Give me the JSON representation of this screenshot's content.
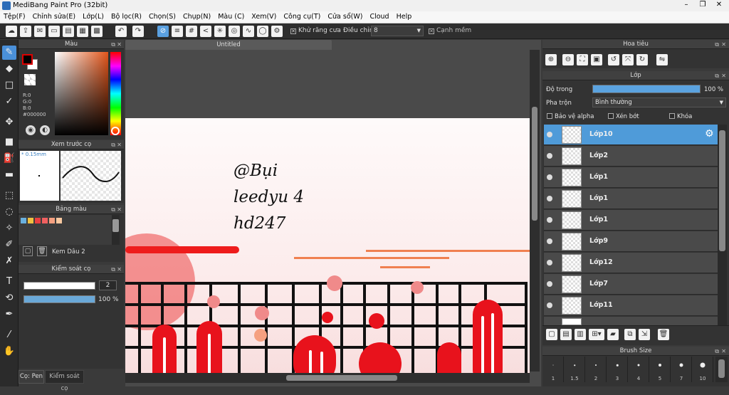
{
  "window": {
    "title": "MediBang Paint Pro (32bit)",
    "minimize": "–",
    "maximize": "❐",
    "close": "✕"
  },
  "menu": [
    "Tệp(F)",
    "Chỉnh sửa(E)",
    "Lớp(L)",
    "Bộ lọc(R)",
    "Chọn(S)",
    "Chụp(N)",
    "Màu (C)",
    "Xem(V)",
    "Công cụ(T)",
    "Cửa sổ(W)",
    "Cloud",
    "Help"
  ],
  "toolbar": {
    "antialias_label": "Khử răng cưa",
    "adjust_label": "Điều chỉnh",
    "adjust_value": "8",
    "smooth_edge_label": "Cạnh mềm"
  },
  "color_panel": {
    "title": "Màu",
    "r": "R:0",
    "g": "G:0",
    "b": "B:0",
    "hex": "#000000"
  },
  "brush_preview": {
    "title": "Xem trước cọ",
    "size": "* 0.15mm"
  },
  "palette": {
    "title": "Bảng màu",
    "name": "Kem Dâu 2",
    "colors": [
      "#6ab0de",
      "#f0c040",
      "#e84040",
      "#f06060",
      "#f5a080",
      "#f8c8a0"
    ]
  },
  "brush_control": {
    "title": "Kiểm soát cọ",
    "size_value": "2",
    "opacity_value": "100 %",
    "opacity_fraction": 1.0
  },
  "bottom_tabs": [
    "Cọ: Pen",
    "Kiểm soát cọ"
  ],
  "document": {
    "tab": "Untitled",
    "handwriting": [
      "@Bụi",
      "leedyu 4",
      "hd247"
    ]
  },
  "navigator": {
    "title": "Hoa tiêu"
  },
  "layers": {
    "title": "Lớp",
    "opacity_label": "Độ trong",
    "opacity_value": "100 %",
    "opacity_fraction": 1.0,
    "blend_label": "Pha trộn",
    "blend_value": "Bình thường",
    "protect_alpha": "Bảo vệ alpha",
    "clipping": "Xén bớt",
    "lock": "Khóa",
    "items": [
      "Lớp10",
      "Lớp2",
      "Lớp1",
      "Lớp1",
      "Lớp1",
      "Lớp9",
      "Lớp12",
      "Lớp7",
      "Lớp11"
    ]
  },
  "brush_size": {
    "title": "Brush Size",
    "sizes": [
      "1",
      "1.5",
      "2",
      "3",
      "4",
      "5",
      "7",
      "10"
    ]
  }
}
